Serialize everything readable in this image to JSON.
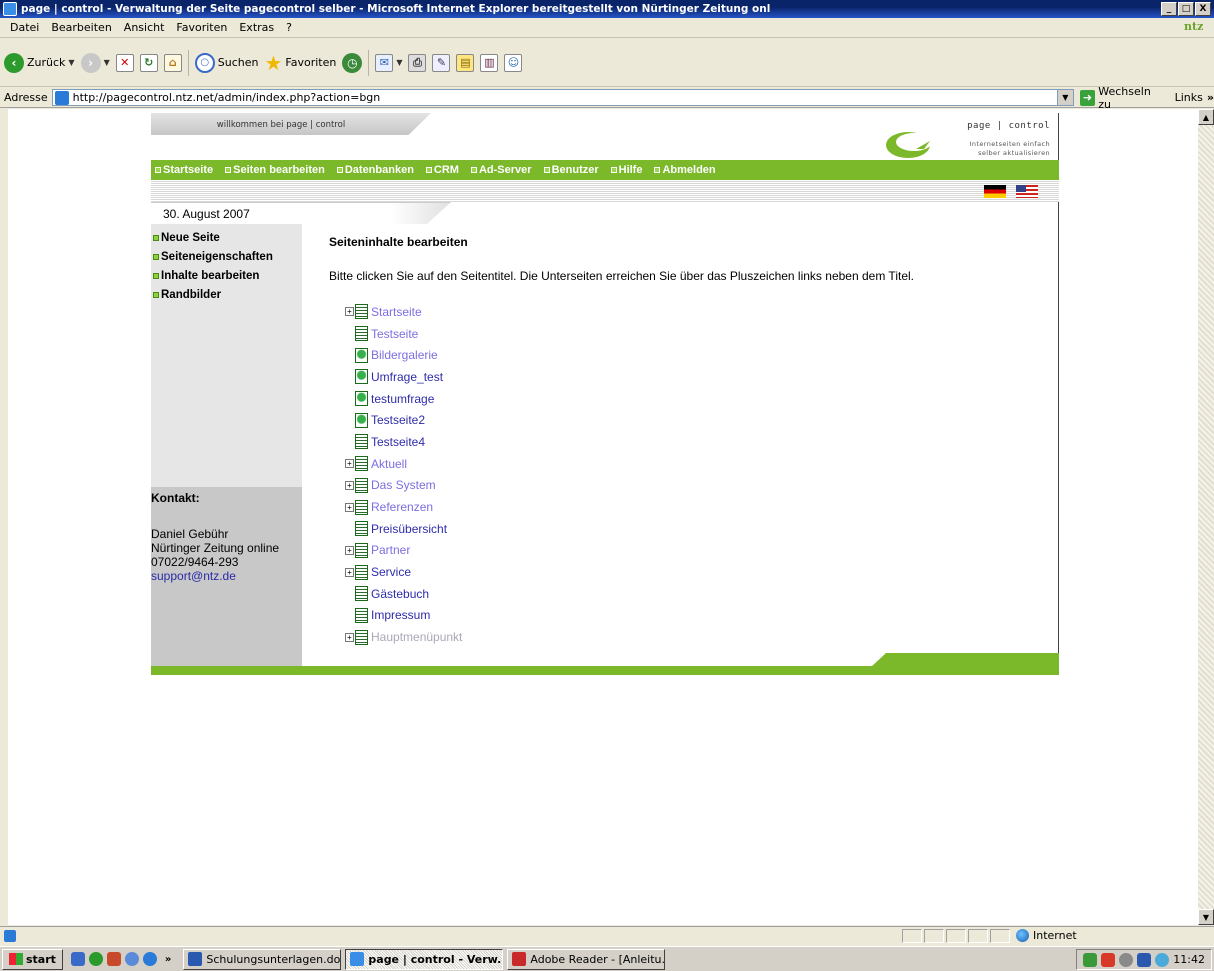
{
  "window": {
    "title": "page | control - Verwaltung der Seite pagecontrol selber - Microsoft Internet Explorer bereitgestellt von Nürtinger Zeitung onl",
    "buttons": [
      "_",
      "□",
      "X"
    ]
  },
  "menubar": {
    "items": [
      "Datei",
      "Bearbeiten",
      "Ansicht",
      "Favoriten",
      "Extras",
      "?"
    ],
    "brand": "ntz"
  },
  "toolbar": {
    "back_label": "Zurück",
    "search_label": "Suchen",
    "favorites_label": "Favoriten"
  },
  "addressbar": {
    "label": "Adresse",
    "url": "http://pagecontrol.ntz.net/admin/index.php?action=bgn",
    "go_label": "Wechseln zu",
    "links_label": "Links",
    "links_chevron": "»"
  },
  "site": {
    "welcome": "willkommen bei page | control",
    "logo_title": "page | control",
    "logo_subtitle_1": "Internetseiten einfach",
    "logo_subtitle_2": "selber aktualisieren",
    "nav": [
      "Startseite",
      "Seiten bearbeiten",
      "Datenbanken",
      "CRM",
      "Ad-Server",
      "Benutzer",
      "Hilfe",
      "Abmelden"
    ],
    "date": "30. August 2007",
    "sidemenu": [
      "Neue Seite",
      "Seiteneigenschaften",
      "Inhalte bearbeiten",
      "Randbilder"
    ],
    "contact": {
      "title": "Kontakt:",
      "name": "Daniel Gebühr",
      "company": "Nürtinger Zeitung online",
      "phone": "07022/9464-293",
      "email": "support@ntz.de"
    },
    "content": {
      "heading": "Seiteninhalte bearbeiten",
      "intro": "Bitte clicken Sie auf den Seitentitel. Die Unterseiten erreichen Sie über das Pluszeichen links neben dem Titel."
    },
    "tree": [
      {
        "label": "Startseite",
        "expand": true,
        "icon": "doc",
        "style": "light"
      },
      {
        "label": "Testseite",
        "expand": false,
        "icon": "doc",
        "style": "light"
      },
      {
        "label": "Bildergalerie",
        "expand": false,
        "icon": "web",
        "style": "light"
      },
      {
        "label": "Umfrage_test",
        "expand": false,
        "icon": "web",
        "style": "dark"
      },
      {
        "label": "testumfrage",
        "expand": false,
        "icon": "web",
        "style": "dark"
      },
      {
        "label": "Testseite2",
        "expand": false,
        "icon": "web",
        "style": "dark"
      },
      {
        "label": "Testseite4",
        "expand": false,
        "icon": "doc",
        "style": "dark"
      },
      {
        "label": "Aktuell",
        "expand": true,
        "icon": "doc",
        "style": "light"
      },
      {
        "label": "Das System",
        "expand": true,
        "icon": "doc",
        "style": "light"
      },
      {
        "label": "Referenzen",
        "expand": true,
        "icon": "doc",
        "style": "light"
      },
      {
        "label": "Preisübersicht",
        "expand": false,
        "icon": "doc",
        "style": "dark"
      },
      {
        "label": "Partner",
        "expand": true,
        "icon": "doc",
        "style": "light"
      },
      {
        "label": "Service",
        "expand": true,
        "icon": "doc",
        "style": "dark"
      },
      {
        "label": "Gästebuch",
        "expand": false,
        "icon": "doc",
        "style": "dark"
      },
      {
        "label": "Impressum",
        "expand": false,
        "icon": "doc",
        "style": "dark"
      },
      {
        "label": "Hauptmenüpunkt",
        "expand": true,
        "icon": "doc",
        "style": "grey"
      }
    ]
  },
  "statusbar": {
    "zone": "Internet"
  },
  "taskbar": {
    "start_label": "start",
    "chevron": "»",
    "tasks": [
      {
        "label": "Schulungsunterlagen.do...",
        "active": false
      },
      {
        "label": "page | control - Verw...",
        "active": true
      },
      {
        "label": "Adobe Reader - [Anleitu...",
        "active": false
      }
    ],
    "clock": "11:42"
  },
  "colors": {
    "accent_green": "#7BB82A",
    "link_light": "#7B6FE0",
    "link_dark": "#2E2CA8"
  }
}
